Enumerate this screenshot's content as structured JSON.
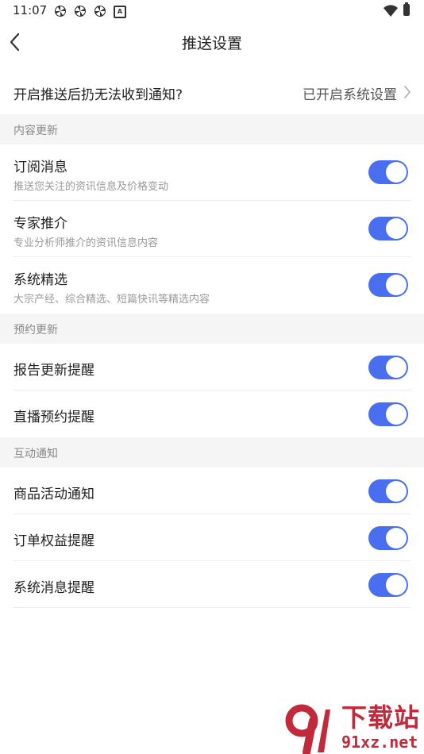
{
  "status_bar": {
    "time": "11:07",
    "notification_icons": [
      "pinwheel-icon",
      "pinwheel-icon",
      "pinwheel-icon",
      "a-badge-icon"
    ],
    "notification_badge": "A"
  },
  "header": {
    "title": "推送设置"
  },
  "system_notice": {
    "question": "开启推送后扔无法收到通知?",
    "status": "已开启系统设置"
  },
  "sections": [
    {
      "header": "内容更新",
      "items": [
        {
          "title": "订阅消息",
          "desc": "推送您关注的资讯信息及价格变动",
          "on": true
        },
        {
          "title": "专家推介",
          "desc": "专业分析师推介的资讯信息内容",
          "on": true
        },
        {
          "title": "系统精选",
          "desc": "大宗产经、综合精选、短篇快讯等精选内容",
          "on": true
        }
      ]
    },
    {
      "header": "预约更新",
      "items": [
        {
          "title": "报告更新提醒",
          "on": true
        },
        {
          "title": "直播预约提醒",
          "on": true
        }
      ]
    },
    {
      "header": "互动通知",
      "items": [
        {
          "title": "商品活动通知",
          "on": true
        },
        {
          "title": "订单权益提醒",
          "on": true
        },
        {
          "title": "系统消息提醒",
          "on": true
        }
      ]
    }
  ],
  "watermark": {
    "logo": "91-logo",
    "name": "下载站",
    "domain": "91xz.net"
  },
  "colors": {
    "toggle_on": "#4a6ef0",
    "section_bg": "#f5f5f5",
    "watermark": "#c02a3a"
  }
}
